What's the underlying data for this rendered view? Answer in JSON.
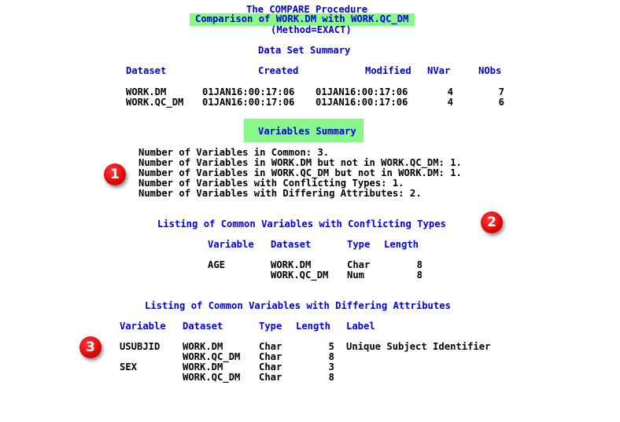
{
  "header": {
    "procedure": "The COMPARE Procedure",
    "comparison": "Comparison of WORK.DM with WORK.QC_DM",
    "method": "(Method=EXACT)"
  },
  "dataset_summary": {
    "title": "Data Set Summary",
    "columns": [
      "Dataset",
      "Created",
      "Modified",
      "NVar",
      "NObs"
    ],
    "rows": [
      {
        "dataset": "WORK.DM",
        "created": "01JAN16:00:17:06",
        "modified": "01JAN16:00:17:06",
        "nvar": "4",
        "nobs": "7"
      },
      {
        "dataset": "WORK.QC_DM",
        "created": "01JAN16:00:17:06",
        "modified": "01JAN16:00:17:06",
        "nvar": "4",
        "nobs": "6"
      }
    ]
  },
  "variables_summary": {
    "title": "Variables Summary",
    "lines": [
      "Number of Variables in Common: 3.",
      "Number of Variables in WORK.DM but not in WORK.QC_DM: 1.",
      "Number of Variables in WORK.QC_DM but not in WORK.DM: 1.",
      "Number of Variables with Conflicting Types: 1.",
      "Number of Variables with Differing Attributes: 2."
    ]
  },
  "conflicting_types": {
    "title": "Listing of Common Variables with Conflicting Types",
    "columns": [
      "Variable",
      "Dataset",
      "Type",
      "Length"
    ],
    "rows": [
      {
        "variable": "AGE",
        "dataset": "WORK.DM",
        "type": "Char",
        "length": "8"
      },
      {
        "variable": "",
        "dataset": "WORK.QC_DM",
        "type": "Num",
        "length": "8"
      }
    ]
  },
  "differing_attributes": {
    "title": "Listing of Common Variables with Differing Attributes",
    "columns": [
      "Variable",
      "Dataset",
      "Type",
      "Length",
      "Label"
    ],
    "rows": [
      {
        "variable": "USUBJID",
        "dataset": "WORK.DM",
        "type": "Char",
        "length": "5",
        "label": "Unique Subject Identifier"
      },
      {
        "variable": "",
        "dataset": "WORK.QC_DM",
        "type": "Char",
        "length": "8",
        "label": ""
      },
      {
        "variable": "SEX",
        "dataset": "WORK.DM",
        "type": "Char",
        "length": "3",
        "label": ""
      },
      {
        "variable": "",
        "dataset": "WORK.QC_DM",
        "type": "Char",
        "length": "8",
        "label": ""
      }
    ]
  },
  "badges": [
    "1",
    "2",
    "3"
  ],
  "colors": {
    "heading_blue": "#0000e0",
    "highlight_green": "#88f888",
    "badge_red": "#d40000"
  }
}
